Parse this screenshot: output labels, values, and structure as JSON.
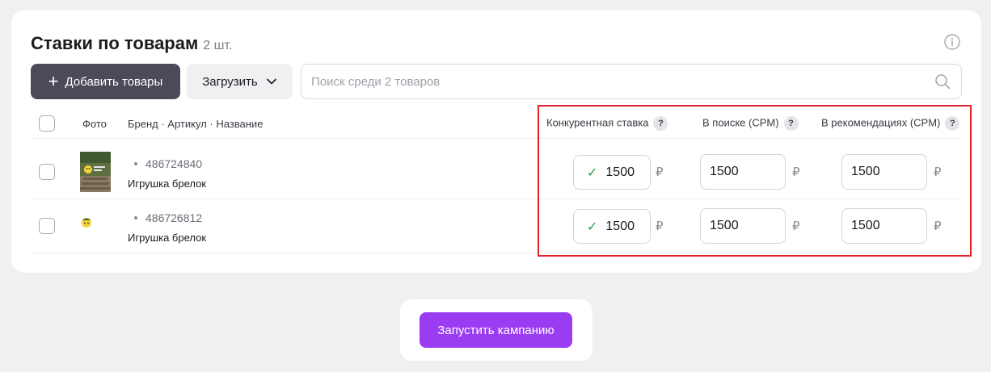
{
  "header": {
    "title": "Ставки по товарам",
    "count": "2 шт."
  },
  "toolbar": {
    "add_label": "Добавить товары",
    "upload_label": "Загрузить",
    "search_placeholder": "Поиск среди 2 товаров"
  },
  "table": {
    "headers": {
      "photo": "Фото",
      "name": "Бренд · Артикул · Название",
      "competitive_bid": "Конкурентная ставка",
      "search_cpm": "В поиске (CPM)",
      "recommend_cpm": "В рекомендациях (CPM)",
      "help": "?"
    },
    "rows": [
      {
        "article": "486724840",
        "name": "Игрушка брелок",
        "competitive_bid": "1500",
        "search_cpm": "1500",
        "recommend_cpm": "1500",
        "checked": false
      },
      {
        "article": "486726812",
        "name": "Игрушка брелок",
        "competitive_bid": "1500",
        "search_cpm": "1500",
        "recommend_cpm": "1500",
        "checked": false
      }
    ],
    "currency": "₽",
    "check_mark": "✓"
  },
  "footer": {
    "launch_label": "Запустить кампанию"
  },
  "colors": {
    "primary_dark": "#4a4a58",
    "launch": "#9a3cf2",
    "highlight": "#e8202a",
    "check": "#2f9e44"
  }
}
